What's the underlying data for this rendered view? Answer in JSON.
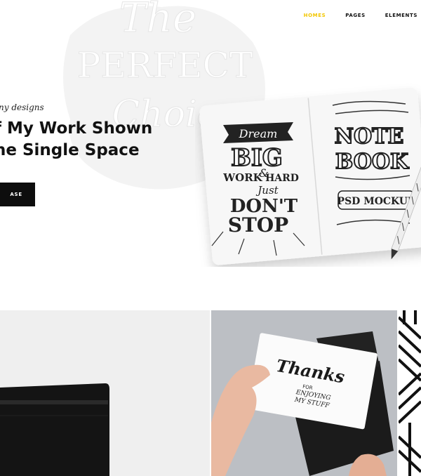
{
  "nav": {
    "items": [
      {
        "label": "HOMES",
        "active": true
      },
      {
        "label": "PAGES",
        "active": false
      },
      {
        "label": "ELEMENTS",
        "active": false
      }
    ],
    "active_color": "#f2c600"
  },
  "hero": {
    "watermark_text": [
      "The",
      "PERFECT",
      "Choice"
    ],
    "eyebrow": "ny designs",
    "headline_line1": "f My Work Shown",
    "headline_line2": "ne Single Space",
    "cta_label": "ASE",
    "mockup_text": {
      "left_page": [
        "Dream",
        "BIG",
        "WORK",
        "&",
        "HARD",
        "Just",
        "DON'T",
        "STOP"
      ],
      "right_page": [
        "NOTE",
        "BOOK",
        "PSD MOCKUP"
      ]
    }
  },
  "portfolio": {
    "card_text": [
      "Thanks",
      "FOR",
      "ENJOYING",
      "MY STUFF"
    ]
  }
}
